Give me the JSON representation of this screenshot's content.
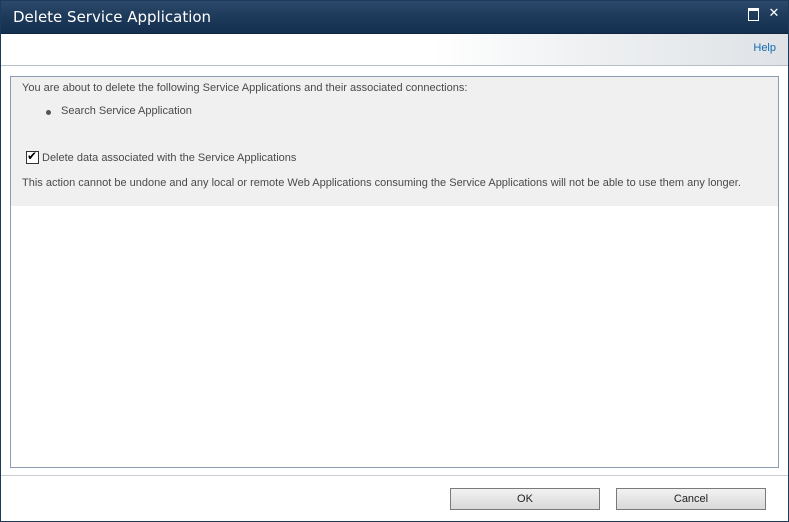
{
  "dialog": {
    "title": "Delete Service Application",
    "help_label": "Help",
    "message": "You are about to delete the following Service Applications and their associated connections:",
    "applications": [
      "Search Service Application"
    ],
    "checkbox": {
      "label": "Delete data associated with the Service Applications",
      "checked": true
    },
    "warning": "This action cannot be undone and any local or remote Web Applications consuming the Service Applications will not be able to use them any longer.",
    "ok_label": "OK",
    "cancel_label": "Cancel"
  },
  "colors": {
    "titlebar": "#1f3b5c",
    "link": "#0f6db3",
    "panel": "#f0f0f0"
  },
  "icons": {
    "maximize": "maximize-icon",
    "close": "close-icon",
    "bullet": "bullet-icon",
    "check": "checkmark-icon"
  }
}
